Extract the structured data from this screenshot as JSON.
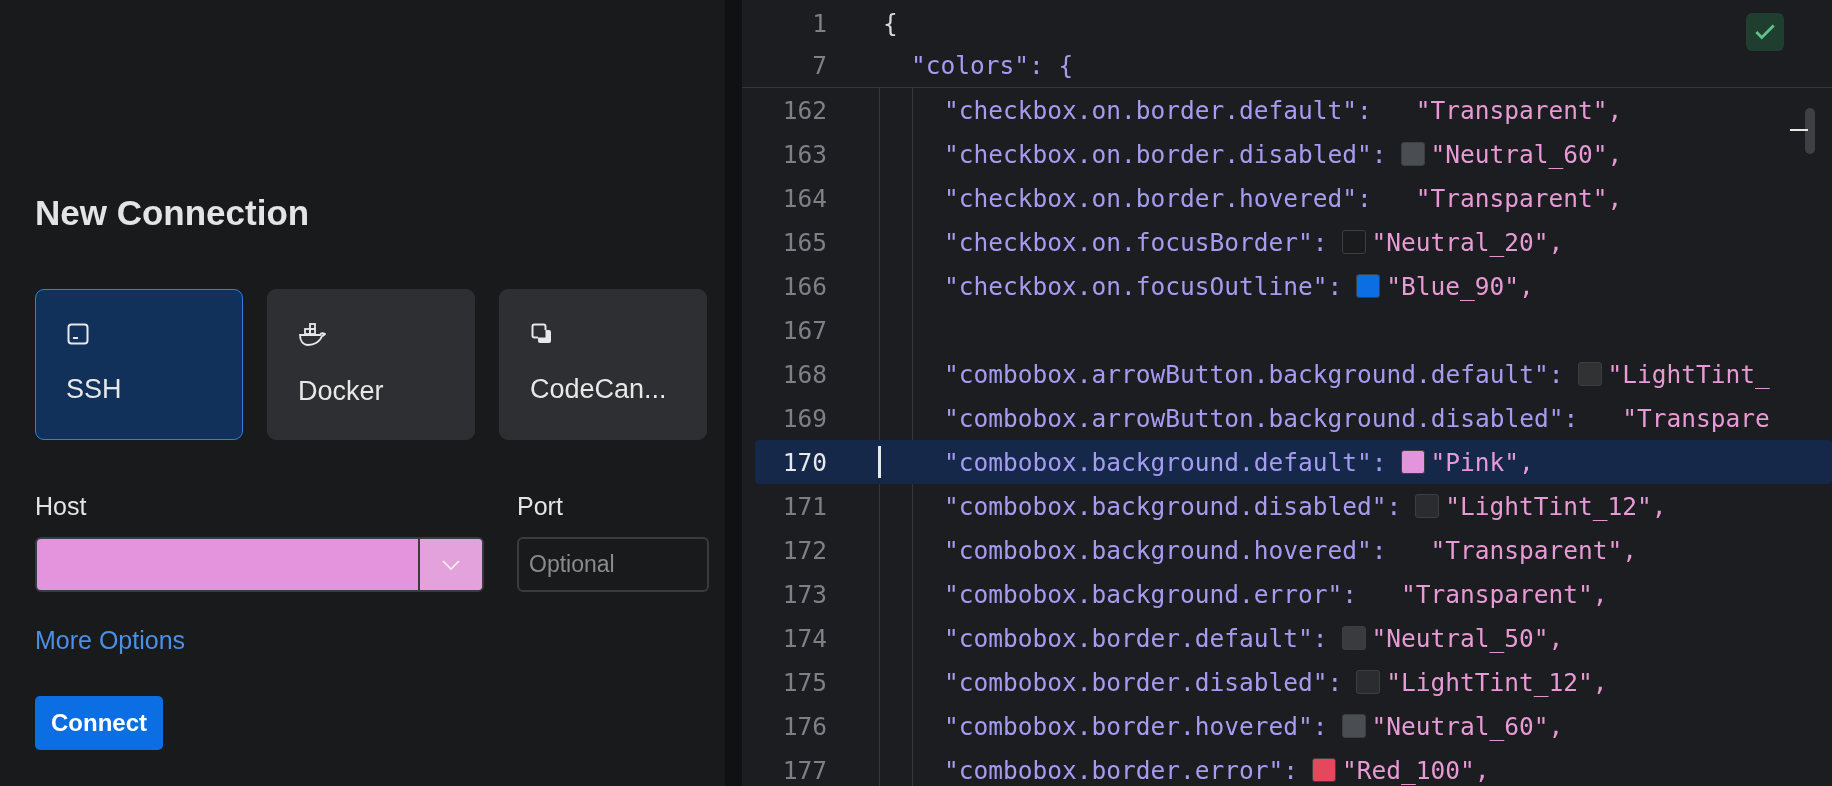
{
  "connection_panel": {
    "title": "New Connection",
    "types": [
      {
        "kind": "terminal",
        "label": "SSH",
        "selected": true
      },
      {
        "kind": "docker",
        "label": "Docker",
        "selected": false
      },
      {
        "kind": "stack",
        "label": "CodeCan...",
        "selected": false
      }
    ],
    "host": {
      "label": "Host"
    },
    "port": {
      "label": "Port",
      "placeholder": "Optional"
    },
    "more_options": "More Options",
    "connect_button": "Connect"
  },
  "editor": {
    "sticky_lines": [
      {
        "number": "1",
        "text": "{"
      },
      {
        "number": "7",
        "text": "\"colors\": {"
      }
    ],
    "lines": [
      {
        "number": "162",
        "kind": "entry",
        "key": "\"checkbox.on.border.default\":",
        "value": "\"Transparent\",",
        "selected": false
      },
      {
        "number": "163",
        "kind": "entry",
        "key": "\"checkbox.on.border.disabled\":",
        "color": "#4a4d51",
        "value": "\"Neutral_60\",",
        "selected": false
      },
      {
        "number": "164",
        "kind": "entry",
        "key": "\"checkbox.on.border.hovered\":",
        "value": "\"Transparent\",",
        "selected": false
      },
      {
        "number": "165",
        "kind": "entry",
        "key": "\"checkbox.on.focusBorder\":",
        "color": "#1a1b1d",
        "value": "\"Neutral_20\",",
        "selected": false
      },
      {
        "number": "166",
        "kind": "entry",
        "key": "\"checkbox.on.focusOutline\":",
        "color": "#0b6fe3",
        "value": "\"Blue_90\",",
        "selected": false
      },
      {
        "number": "167",
        "kind": "blank",
        "selected": false
      },
      {
        "number": "168",
        "kind": "entry",
        "key": "\"combobox.arrowButton.background.default\":",
        "color": "#303234",
        "value": "\"LightTint_",
        "selected": false
      },
      {
        "number": "169",
        "kind": "entry",
        "key": "\"combobox.arrowButton.background.disabled\":",
        "value": "\"Transpare",
        "selected": false
      },
      {
        "number": "170",
        "kind": "entry",
        "key": "\"combobox.background.default\":",
        "color": "#e394dc",
        "value": "\"Pink\",",
        "selected": true
      },
      {
        "number": "171",
        "kind": "entry",
        "key": "\"combobox.background.disabled\":",
        "color": "#2b2c2f",
        "value": "\"LightTint_12\",",
        "selected": false
      },
      {
        "number": "172",
        "kind": "entry",
        "key": "\"combobox.background.hovered\":",
        "value": "\"Transparent\",",
        "selected": false
      },
      {
        "number": "173",
        "kind": "entry",
        "key": "\"combobox.background.error\":",
        "value": "\"Transparent\",",
        "selected": false
      },
      {
        "number": "174",
        "kind": "entry",
        "key": "\"combobox.border.default\":",
        "color": "#393b3f",
        "value": "\"Neutral_50\",",
        "selected": false
      },
      {
        "number": "175",
        "kind": "entry",
        "key": "\"combobox.border.disabled\":",
        "color": "#2b2c2f",
        "value": "\"LightTint_12\",",
        "selected": false
      },
      {
        "number": "176",
        "kind": "entry",
        "key": "\"combobox.border.hovered\":",
        "color": "#4a4d51",
        "value": "\"Neutral_60\",",
        "selected": false
      },
      {
        "number": "177",
        "kind": "entry",
        "key": "\"combobox.border.error\":",
        "color": "#e5485d",
        "value": "\"Red_100\",",
        "selected": false
      }
    ]
  }
}
